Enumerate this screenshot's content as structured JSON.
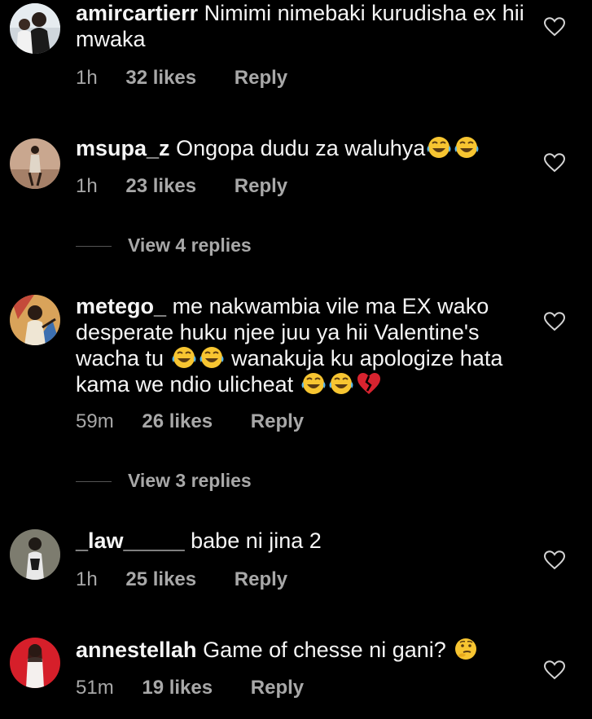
{
  "comments": [
    {
      "username": "amircartierr",
      "text_parts": [
        "Nimimi nimebaki kurudisha ex hii mwaka"
      ],
      "time": "1h",
      "likes": "32 likes",
      "reply": "Reply",
      "avatar_icon": "user-avatar-photo"
    },
    {
      "username": "msupa_z",
      "text_parts": [
        "Ongopa dudu za waluhya"
      ],
      "emojis": [
        "face-with-tears-of-joy",
        "face-with-tears-of-joy"
      ],
      "time": "1h",
      "likes": "23 likes",
      "reply": "Reply",
      "view_replies": "View 4 replies",
      "avatar_icon": "user-avatar-photo"
    },
    {
      "username": "metego_",
      "text_parts": [
        "me nakwambia vile ma EX wako desperate huku njee juu ya hii Valentine's wacha tu",
        "wanakuja ku apologize hata kama we ndio ulicheat"
      ],
      "emojis": [
        "face-with-tears-of-joy",
        "broken-heart"
      ],
      "time": "59m",
      "likes": "26 likes",
      "reply": "Reply",
      "view_replies": "View 3 replies",
      "avatar_icon": "user-avatar-photo"
    },
    {
      "username": "_law_____",
      "text_parts": [
        "babe ni jina 2"
      ],
      "time": "1h",
      "likes": "25 likes",
      "reply": "Reply",
      "avatar_icon": "user-avatar-photo"
    },
    {
      "username": "annestellah",
      "text_parts": [
        "Game of chesse ni gani?"
      ],
      "emojis": [
        "thinking-face"
      ],
      "time": "51m",
      "likes": "19 likes",
      "reply": "Reply",
      "avatar_icon": "user-avatar-photo"
    }
  ],
  "colors": {
    "background": "#000000",
    "primary_text": "#f5f5f5",
    "secondary_text": "#a8a8a8",
    "divider": "#555555"
  }
}
